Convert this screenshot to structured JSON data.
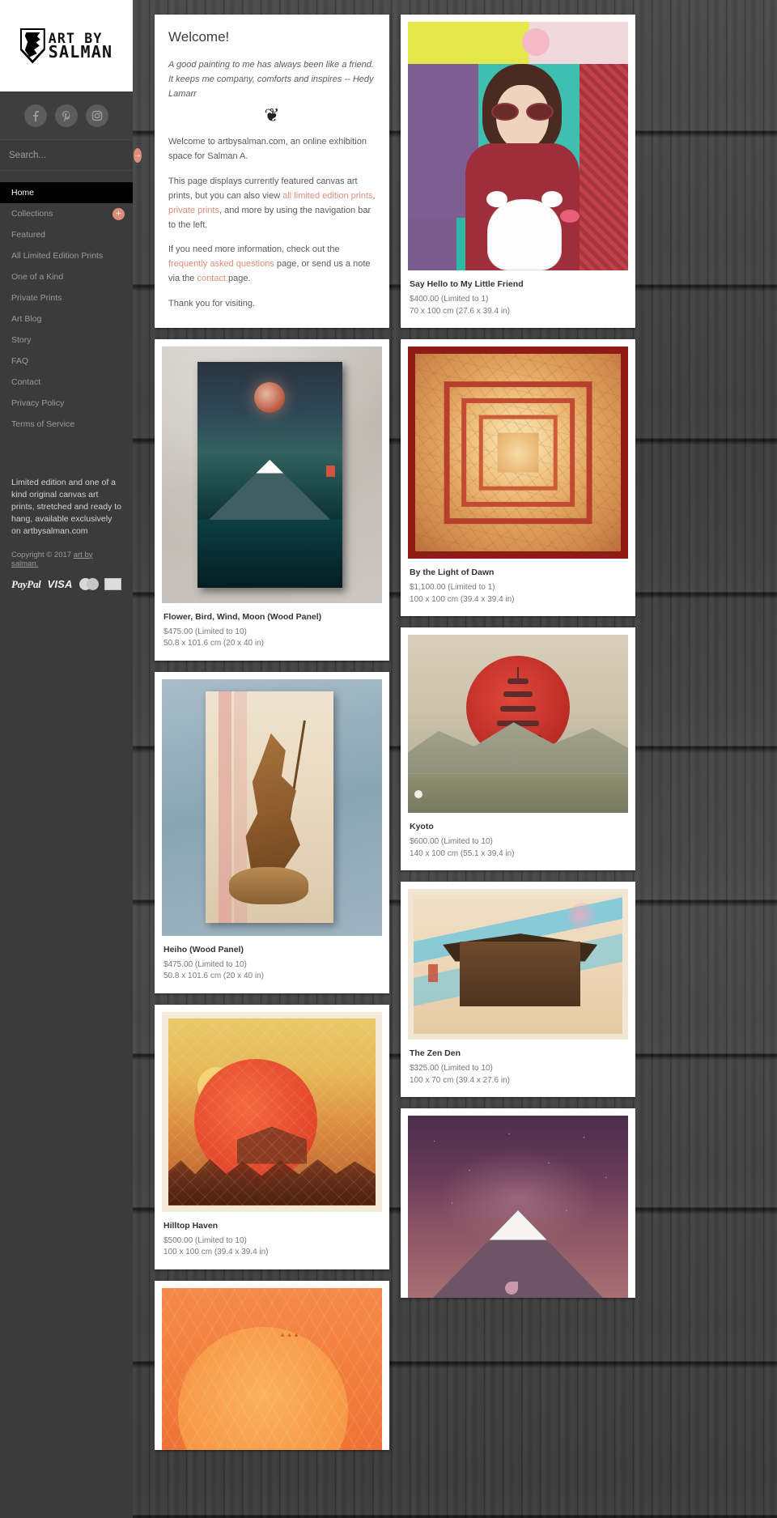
{
  "site": {
    "logo_line1": "ART BY",
    "logo_line2": "SALMAN"
  },
  "sidebar": {
    "social": [
      {
        "name": "facebook-icon",
        "glyph": "f"
      },
      {
        "name": "pinterest-icon",
        "glyph": "P"
      },
      {
        "name": "instagram-icon",
        "glyph": "▣"
      }
    ],
    "search": {
      "placeholder": "Search...",
      "submit_glyph": "→"
    },
    "nav": [
      {
        "label": "Home",
        "active": true,
        "badge": null
      },
      {
        "label": "Collections",
        "active": false,
        "badge": "+"
      },
      {
        "label": "Featured",
        "active": false,
        "badge": null
      },
      {
        "label": "All Limited Edition Prints",
        "active": false,
        "badge": null
      },
      {
        "label": "One of a Kind",
        "active": false,
        "badge": null
      },
      {
        "label": "Private Prints",
        "active": false,
        "badge": null
      },
      {
        "label": "Art Blog",
        "active": false,
        "badge": null
      },
      {
        "label": "Story",
        "active": false,
        "badge": null
      },
      {
        "label": "FAQ",
        "active": false,
        "badge": null
      },
      {
        "label": "Contact",
        "active": false,
        "badge": null
      },
      {
        "label": "Privacy Policy",
        "active": false,
        "badge": null
      },
      {
        "label": "Terms of Service",
        "active": false,
        "badge": null
      }
    ],
    "footer_blurb": "Limited edition and one of a kind original canvas art prints, stretched and ready to hang, available exclusively on artbysalman.com",
    "copyright_prefix": "Copyright © 2017 ",
    "copyright_link": "art by salman.",
    "payments": [
      {
        "name": "paypal-logo",
        "label": "PayPal"
      },
      {
        "name": "visa-logo",
        "label": "VISA"
      },
      {
        "name": "mastercard-logo",
        "label": "MasterCard"
      },
      {
        "name": "amex-logo",
        "label": "AMEX"
      }
    ]
  },
  "welcome": {
    "heading": "Welcome!",
    "quote": "A good painting to me has always been like a friend. It keeps me company, comforts and inspires -- Hedy Lamarr",
    "flourish": "؃",
    "p1": "Welcome to artbysalman.com, an online exhibition space for Salman A.",
    "p2_a": "This page displays currently featured canvas art prints, but you can also view ",
    "p2_link1": "all limited edition prints",
    "p2_b": ", ",
    "p2_link2": "private prints",
    "p2_c": ", and more by using the navigation bar to the left.",
    "p3_a": "If you need more information, check out the ",
    "p3_link1": "frequently asked questions",
    "p3_b": " page, or send us a note via the ",
    "p3_link2": "contact",
    "p3_c": " page.",
    "p4": "Thank you for visiting."
  },
  "artworks": {
    "left": [
      {
        "title": "Flower, Bird, Wind, Moon (Wood Panel)",
        "price": "$475.00 (Limited to 10)",
        "size": "50.8 x 101.6 cm (20 x 40 in)",
        "art": "fbwm"
      },
      {
        "title": "Heiho (Wood Panel)",
        "price": "$475.00 (Limited to 10)",
        "size": "50.8 x 101.6 cm (20 x 40 in)",
        "art": "heiho"
      },
      {
        "title": "Hilltop Haven",
        "price": "$500.00 (Limited to 10)",
        "size": "100 x 100 cm (39.4 x 39.4 in)",
        "art": "hilltop"
      },
      {
        "title": "",
        "price": "",
        "size": "",
        "art": "orange"
      }
    ],
    "right": [
      {
        "title": "Say Hello to My Little Friend",
        "price": "$400.00 (Limited to 1)",
        "size": "70 x 100 cm (27.6 x 39.4 in)",
        "art": "kitty"
      },
      {
        "title": "By the Light of Dawn",
        "price": "$1,100.00 (Limited to 1)",
        "size": "100 x 100 cm (39.4 x 39.4 in)",
        "art": "dawn"
      },
      {
        "title": "Kyoto",
        "price": "$600.00 (Limited to 10)",
        "size": "140 x 100 cm (55.1 x 39.4 in)",
        "art": "kyoto"
      },
      {
        "title": "The Zen Den",
        "price": "$325.00 (Limited to 10)",
        "size": "100 x 70 cm (39.4 x 27.6 in)",
        "art": "zen"
      },
      {
        "title": "",
        "price": "",
        "size": "",
        "art": "aurora"
      }
    ]
  },
  "colors": {
    "accent": "#dd8d78",
    "sidebar_bg": "#3b3b3b",
    "active_nav_bg": "#000000"
  }
}
